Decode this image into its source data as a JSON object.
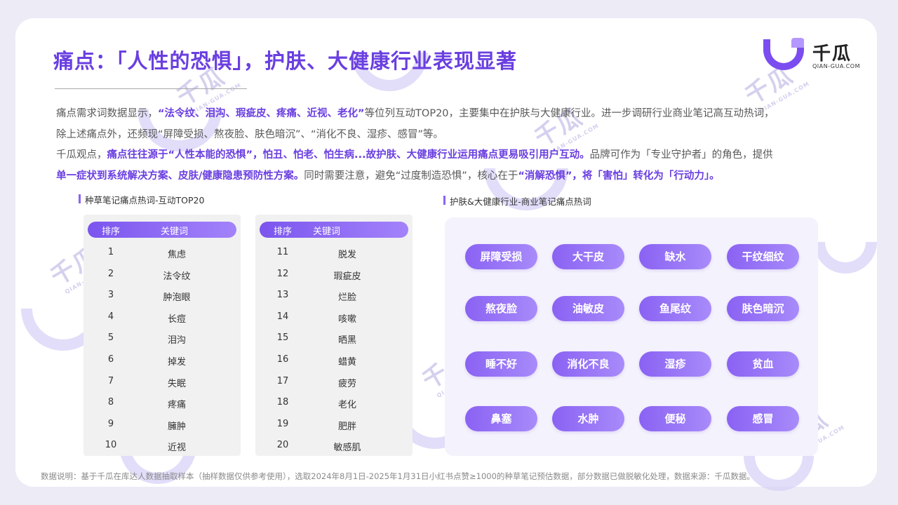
{
  "title": "痛点：「人性的恐惧」，护肤、大健康行业表现显著",
  "logo": {
    "name": "千瓜",
    "sub": "QIAN-GUA.COM"
  },
  "watermark": {
    "big": "千瓜",
    "small": "QIAN-GUA.COM"
  },
  "paragraph": {
    "l1_a": "痛点需求词数据显示，",
    "l1_b": "“法令纹、泪沟、瑕疵皮、疼痛、近视、老化”",
    "l1_c": "等位列互动TOP20，主要集中在护肤与大健康行业。进一步调研行业商业笔记高互动热词，",
    "l2": "除上述痛点外，还频现“屏障受损、熬夜脸、肤色暗沉”、“消化不良、湿疹、感冒”等。",
    "l3_a": "千瓜观点，",
    "l3_b": "痛点往往源于“人性本能的恐惧”，怕丑、怕老、怕生病...故护肤、大健康行业运用痛点更易吸引用户互动。",
    "l3_c": "品牌可作为「专业守护者」的角色，提供",
    "l4_a": "单一症状到系统解决方案、皮肤/健康隐患预防性方案。",
    "l4_b": "同时需要注意，避免“过度制造恐惧”，核心在于",
    "l4_c": "“消解恐惧”，将「害怕」转化为「行动力」。"
  },
  "left_section": {
    "label": "种草笔记痛点热词-互动TOP20",
    "header": {
      "rank": "排序",
      "keyword": "关键词"
    },
    "col1": [
      {
        "rank": "1",
        "keyword": "焦虑"
      },
      {
        "rank": "2",
        "keyword": "法令纹"
      },
      {
        "rank": "3",
        "keyword": "肿泡眼"
      },
      {
        "rank": "4",
        "keyword": "长痘"
      },
      {
        "rank": "5",
        "keyword": "泪沟"
      },
      {
        "rank": "6",
        "keyword": "掉发"
      },
      {
        "rank": "7",
        "keyword": "失眠"
      },
      {
        "rank": "8",
        "keyword": "疼痛"
      },
      {
        "rank": "9",
        "keyword": "臃肿"
      },
      {
        "rank": "10",
        "keyword": "近视"
      }
    ],
    "col2": [
      {
        "rank": "11",
        "keyword": "脱发"
      },
      {
        "rank": "12",
        "keyword": "瑕疵皮"
      },
      {
        "rank": "13",
        "keyword": "烂脸"
      },
      {
        "rank": "14",
        "keyword": "咳嗽"
      },
      {
        "rank": "15",
        "keyword": "晒黑"
      },
      {
        "rank": "16",
        "keyword": "蜡黄"
      },
      {
        "rank": "17",
        "keyword": "疲劳"
      },
      {
        "rank": "18",
        "keyword": "老化"
      },
      {
        "rank": "19",
        "keyword": "肥胖"
      },
      {
        "rank": "20",
        "keyword": "敏感肌"
      }
    ]
  },
  "right_section": {
    "label": "护肤&大健康行业-商业笔记痛点热词",
    "tags": [
      [
        "屏障受损",
        "大干皮",
        "缺水",
        "干纹细纹"
      ],
      [
        "熬夜脸",
        "油敏皮",
        "鱼尾纹",
        "肤色暗沉"
      ],
      [
        "睡不好",
        "消化不良",
        "湿疹",
        "贫血"
      ],
      [
        "鼻塞",
        "水肿",
        "便秘",
        "感冒"
      ]
    ]
  },
  "footer": "数据说明：基于千瓜在库达人数据抽取样本（抽样数据仅供参考使用），选取2024年8月1日-2025年1月31日小红书点赞≥1000的种草笔记预估数据，部分数据已做脱敏化处理，数据来源：千瓜数据。",
  "colors": {
    "accent": "#6a3fe0",
    "tag": "#8a62f3",
    "panel": "#f1f1f1"
  }
}
